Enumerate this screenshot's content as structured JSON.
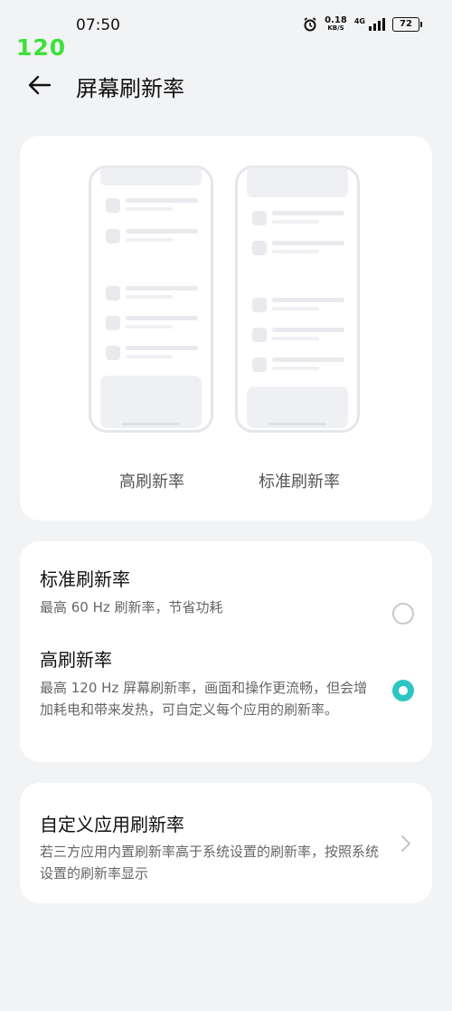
{
  "status_bar": {
    "time": "07:50",
    "fps_overlay": "120",
    "net_speed_value": "0.18",
    "net_speed_unit": "KB/S",
    "network_type": "4G",
    "battery": "72",
    "icons": [
      "alarm-icon",
      "signal-icon",
      "battery-icon"
    ]
  },
  "header": {
    "back_icon": "arrow-left-icon",
    "title": "屏幕刷新率"
  },
  "preview": {
    "left_label": "高刷新率",
    "right_label": "标准刷新率"
  },
  "options": [
    {
      "title": "标准刷新率",
      "description": "最高 60 Hz 刷新率，节省功耗",
      "selected": false
    },
    {
      "title": "高刷新率",
      "description": "最高 120 Hz 屏幕刷新率，画面和操作更流畅，但会增加耗电和带来发热，可自定义每个应用的刷新率。",
      "selected": true
    }
  ],
  "custom": {
    "title": "自定义应用刷新率",
    "description": "若三方应用内置刷新率高于系统设置的刷新率，按照系统设置的刷新率显示",
    "chevron_icon": "chevron-right-icon"
  },
  "colors": {
    "accent": "#2ec6c4",
    "fps_overlay": "#3ee13a",
    "background": "#f2f3f5",
    "card": "#ffffff"
  }
}
